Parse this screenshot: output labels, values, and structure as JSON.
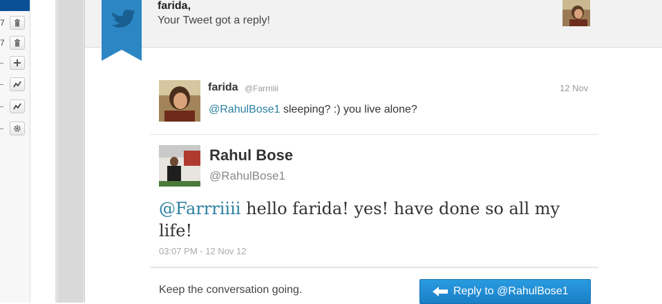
{
  "sidebar": {
    "rows": [
      {
        "num": "7",
        "icon": "trash-icon"
      },
      {
        "num": "7",
        "icon": "trash-icon"
      },
      {
        "num": "",
        "icon": "plus-icon"
      },
      {
        "num": "",
        "icon": "chart-icon"
      },
      {
        "num": "",
        "icon": "chart-icon"
      },
      {
        "num": "",
        "icon": "gear-icon"
      }
    ]
  },
  "header": {
    "name": "farida,",
    "message": "Your Tweet got a reply!"
  },
  "original_tweet": {
    "name": "farida",
    "handle": "@Farrriiii",
    "date": "12 Nov",
    "mention": "@RahulBose1",
    "text": " sleeping? :) you live alone?"
  },
  "reply_tweet": {
    "name": "Rahul Bose",
    "handle": "@RahulBose1",
    "mention": "@Farrriiii",
    "text": " hello farida! yes! have done so all my life!",
    "timestamp": "03:07 PM - 12 Nov 12"
  },
  "footer": {
    "prompt": "Keep the conversation going.",
    "reply_button_label": "Reply to @RahulBose1"
  },
  "colors": {
    "accent": "#1d8bd6",
    "mention": "#2a7fa0",
    "ribbon": "#2d86c4"
  }
}
